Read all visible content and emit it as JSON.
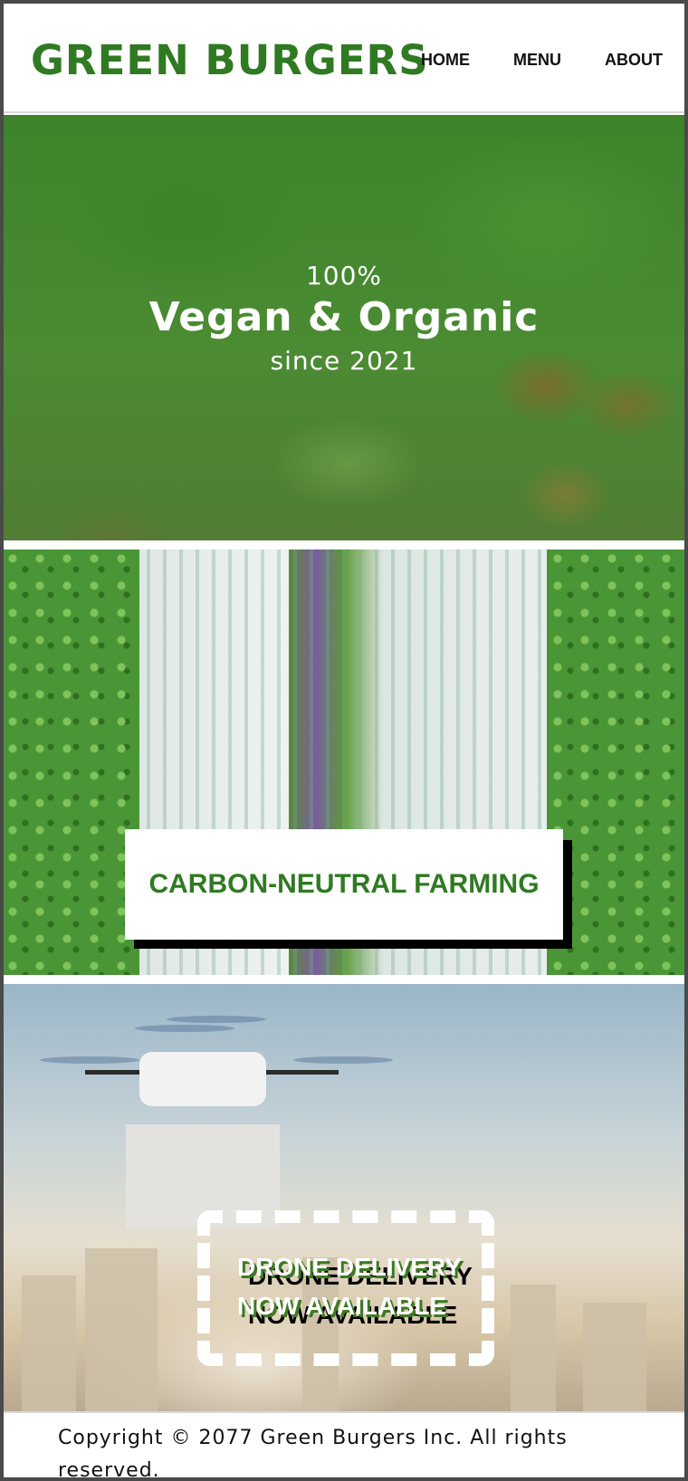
{
  "header": {
    "logo": "GREEN BURGERS",
    "nav": [
      "HOME",
      "MENU",
      "ABOUT"
    ]
  },
  "hero": {
    "line1": "100%",
    "line2": "Vegan & Organic",
    "line3": "since 2021"
  },
  "farming": {
    "card_label": "CARBON-NEUTRAL FARMING"
  },
  "drone": {
    "line1": "DRONE DELIVERY",
    "line2": "NOW AVAILABLE"
  },
  "footer": {
    "copyright": "Copyright © 2077 Green Burgers Inc. All rights reserved."
  },
  "colors": {
    "brand_green": "#2f7a22",
    "footer_text": "#111111"
  }
}
